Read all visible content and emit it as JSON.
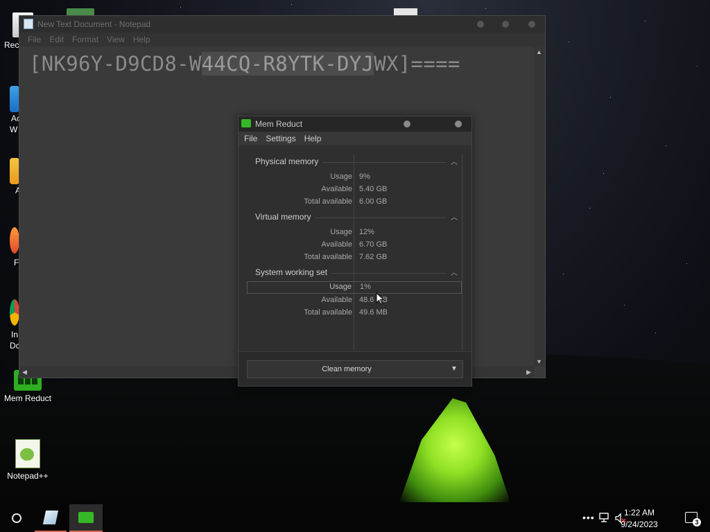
{
  "desktop": {
    "icons": [
      {
        "label": "Rec"
      },
      {
        "label": "Ac"
      },
      {
        "label": "W"
      },
      {
        "label": "A"
      },
      {
        "label": "F"
      },
      {
        "label": "In"
      },
      {
        "label": "Dc"
      },
      {
        "label": "Mem Reduct"
      },
      {
        "label": "Notepad++"
      }
    ]
  },
  "notepad": {
    "title": "New Text Document - Notepad",
    "menu": [
      "File",
      "Edit",
      "Format",
      "View",
      "Help"
    ],
    "text_before": "[NK96Y-D9CD8-W",
    "text_selected": "44CQ-R8YTK-DYJ",
    "text_after": "WX]===="
  },
  "memreduct": {
    "title": "Mem Reduct",
    "menu": [
      "File",
      "Settings",
      "Help"
    ],
    "groups": [
      {
        "name": "Physical memory",
        "rows": [
          {
            "key": "Usage",
            "value": "9%"
          },
          {
            "key": "Available",
            "value": "5.40 GB"
          },
          {
            "key": "Total available",
            "value": "6.00 GB"
          }
        ]
      },
      {
        "name": "Virtual memory",
        "rows": [
          {
            "key": "Usage",
            "value": "12%"
          },
          {
            "key": "Available",
            "value": "6.70 GB"
          },
          {
            "key": "Total available",
            "value": "7.62 GB"
          }
        ]
      },
      {
        "name": "System working set",
        "rows": [
          {
            "key": "Usage",
            "value": "1%"
          },
          {
            "key": "Available",
            "value": "48.6 MB"
          },
          {
            "key": "Total available",
            "value": "49.6 MB"
          }
        ]
      }
    ],
    "clean_button": "Clean memory"
  },
  "taskbar": {
    "time": "1:22 AM",
    "date": "9/24/2023",
    "notification_count": "3"
  },
  "colors": {
    "accent_underline": "#d9694d",
    "mem_reduct_green": "#35b827"
  }
}
